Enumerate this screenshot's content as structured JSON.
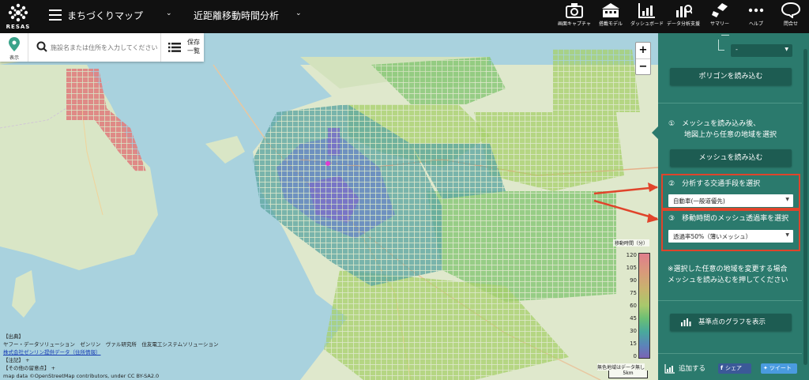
{
  "header": {
    "logo_text": "RESAS",
    "menu_title": "まちづくりマップ",
    "analysis_title": "近距離移動時間分析",
    "tools": [
      {
        "label": "画面キャプチャ",
        "icon": "camera-icon"
      },
      {
        "label": "搭載モデル",
        "icon": "school-icon"
      },
      {
        "label": "ダッシュボード",
        "icon": "dashboard-chart-icon"
      },
      {
        "label": "データ分析支援",
        "icon": "analysis-icon"
      },
      {
        "label": "サマリー",
        "icon": "summary-icon"
      },
      {
        "label": "ヘルプ",
        "icon": "more-icon"
      },
      {
        "label": "問合せ",
        "icon": "chat-icon"
      }
    ]
  },
  "search": {
    "display_label": "表示",
    "placeholder": "施設名または住所を入力してください",
    "saved_label": "保存一覧"
  },
  "map": {
    "zoom_in": "+",
    "zoom_out": "−",
    "legend": {
      "title": "移動時間（分）",
      "ticks": [
        "120",
        "105",
        "90",
        "75",
        "60",
        "45",
        "30",
        "15",
        "0"
      ],
      "nodata": "無色地域はデータ無し",
      "scale": "5km"
    },
    "attribution": {
      "line1": "【出典】",
      "line2": "ヤフー・データソリューション　ゼンリン　ヴァル研究所　住友電工システムソリューション",
      "line3": "株式会社ゼンリン提供データ（住所情報）",
      "line4": "【注記】 +",
      "line5": "【その他の留意点】 +",
      "line6": "map data ©OpenStreetMap contributors, under CC BY-SA2.0"
    }
  },
  "panel": {
    "top_select": "-",
    "load_polygon": "ポリゴンを読み込む",
    "step1_line1": "①　メッシュを読み込み後、",
    "step1_line2": "地図上から任意の地域を選択",
    "load_mesh": "メッシュを読み込む",
    "step2_title": "②　分析する交通手段を選択",
    "step2_value": "自動車(一般道優先)",
    "step3_title": "③　移動時間のメッシュ透過率を選択",
    "step3_value": "透過率50%（薄いメッシュ）",
    "note_line1": "※選択した任意の地域を変更する場合",
    "note_line2": "メッシュを読み込むを押してください",
    "graph_button": "基準点のグラフを表示",
    "add_label": "追加する",
    "share_label": "シェア",
    "tweet_label": "ツイート"
  },
  "colors": {
    "panel_bg": "#2b7a6d",
    "panel_button": "#1d5c52",
    "highlight": "#e0442b",
    "topbar": "#111111"
  }
}
